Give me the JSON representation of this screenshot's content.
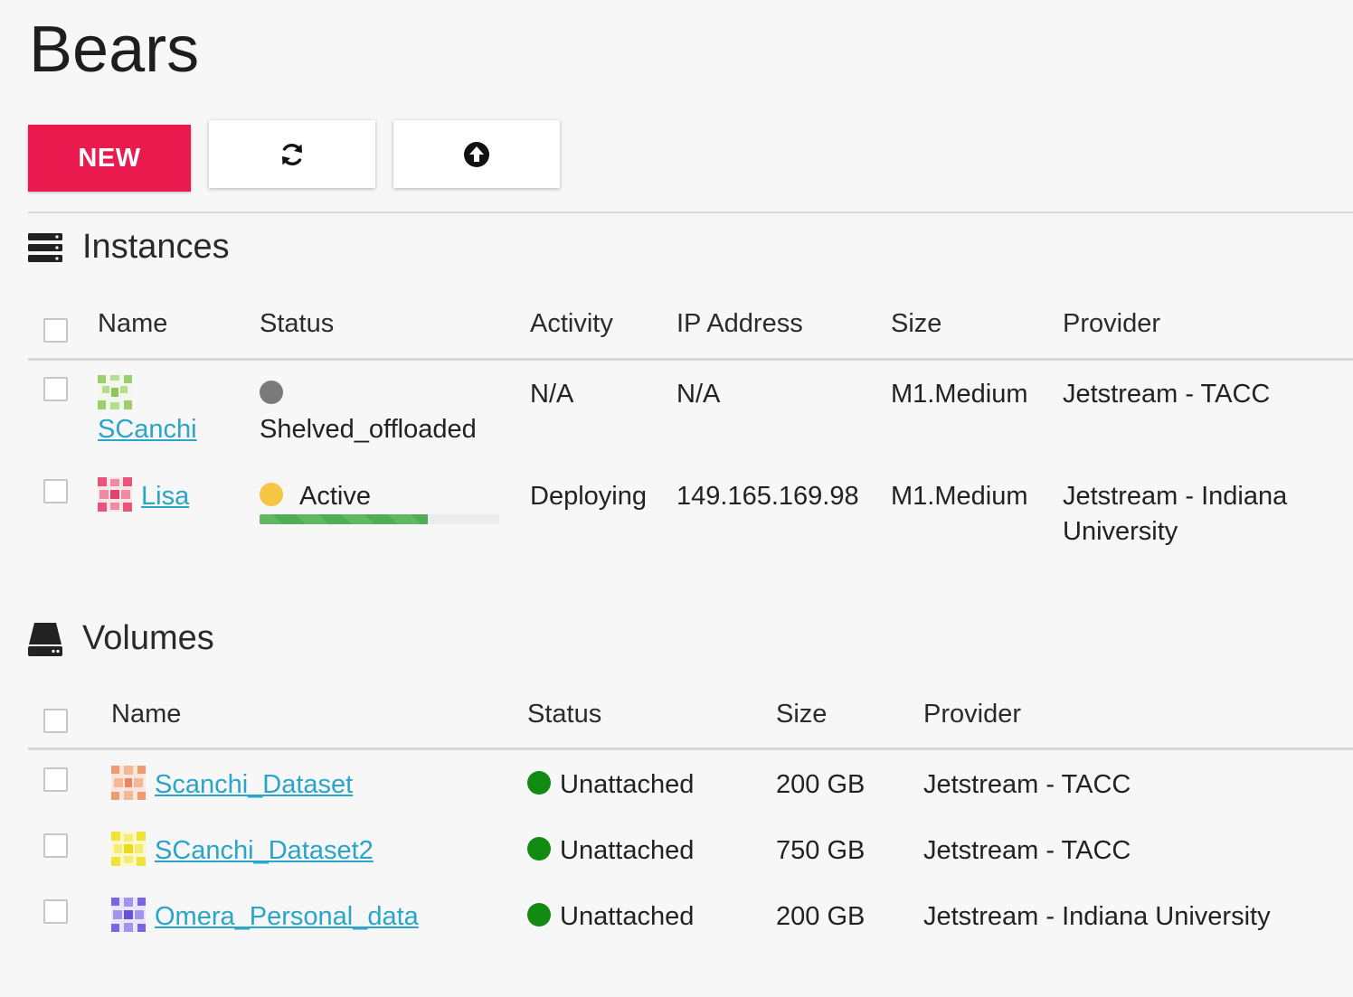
{
  "page": {
    "title": "Bears"
  },
  "toolbar": {
    "new_label": "NEW",
    "refresh_icon": "refresh-icon",
    "upload_icon": "upload-icon",
    "accent": "#ea1a4f"
  },
  "instances": {
    "heading": "Instances",
    "icon": "server-stack-icon",
    "columns": [
      "Name",
      "Status",
      "Activity",
      "IP Address",
      "Size",
      "Provider"
    ],
    "rows": [
      {
        "name": "SCanchi",
        "status": "Shelved_offloaded",
        "status_color": "#7a7a7a",
        "activity": "N/A",
        "ip": "N/A",
        "size": "M1.Medium",
        "provider": "Jetstream - TACC"
      },
      {
        "name": "Lisa",
        "status": "Active",
        "status_color": "#f6c543",
        "activity": "Deploying",
        "ip": "149.165.169.98",
        "size": "M1.Medium",
        "provider_line1": "Jetstream - Indiana",
        "provider_line2": "University",
        "progress": 0.7
      }
    ]
  },
  "volumes": {
    "heading": "Volumes",
    "icon": "hard-drive-icon",
    "columns": [
      "Name",
      "Status",
      "Size",
      "Provider"
    ],
    "rows": [
      {
        "name": "Scanchi_Dataset",
        "status": "Unattached",
        "size": "200 GB",
        "provider": "Jetstream - TACC"
      },
      {
        "name": "SCanchi_Dataset2",
        "status": "Unattached",
        "size": "750 GB",
        "provider": "Jetstream - TACC"
      },
      {
        "name": "Omera_Personal_data",
        "status": "Unattached",
        "size": "200 GB",
        "provider": "Jetstream - Indiana University"
      }
    ],
    "status_color": "#108a10"
  },
  "link_color": "#2aa4c9"
}
